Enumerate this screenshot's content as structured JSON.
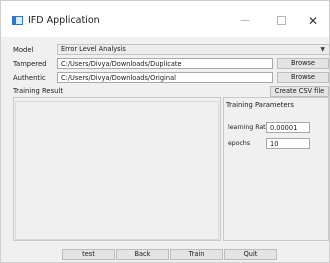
{
  "window": {
    "title": "IFD Application",
    "controls": {
      "minimize": "—",
      "maximize": "□",
      "close": "✕"
    }
  },
  "form": {
    "model_label": "Model",
    "model_value": "Error Level Analysis",
    "tampered_label": "Tampered",
    "tampered_value": "C:/Users/Divya/Downloads/Duplicate",
    "authentic_label": "Authentic",
    "authentic_value": "C:/Users/Divya/Downloads/Original",
    "browse_label": "Browse",
    "create_csv_label": "Create CSV file"
  },
  "training_result": {
    "label": "Training Result"
  },
  "training_params": {
    "title": "Training Parameters",
    "learning_rate_label": "learning Rat",
    "learning_rate_value": "0.00001",
    "epochs_label": "epochs",
    "epochs_value": "10"
  },
  "buttons": {
    "test": "test",
    "back": "Back",
    "train": "Train",
    "quit": "Quit"
  },
  "icons": {
    "app": "app-window-icon",
    "dropdown": "chevron-down-icon"
  }
}
